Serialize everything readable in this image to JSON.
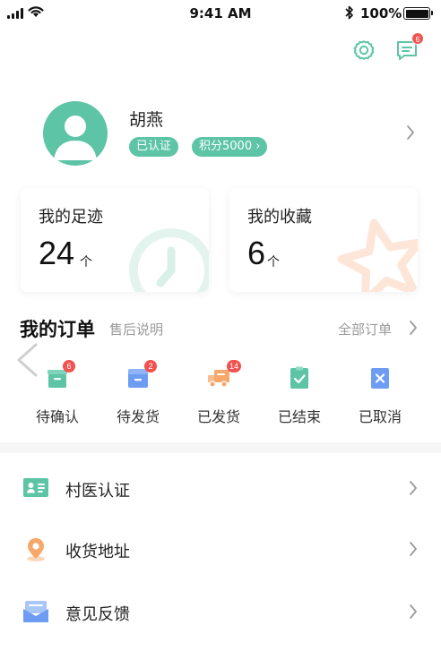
{
  "status_bar": {
    "time": "9:41 AM",
    "battery": "100%"
  },
  "header": {
    "message_badge": "6"
  },
  "profile": {
    "name": "胡燕",
    "verified_label": "已认证",
    "points_label": "积分5000 ›"
  },
  "stats": [
    {
      "title": "我的足迹",
      "value": "24",
      "unit": "个"
    },
    {
      "title": "我的收藏",
      "value": "6",
      "unit": "个"
    }
  ],
  "orders": {
    "title": "我的订单",
    "subtitle": "售后说明",
    "all_label": "全部订单",
    "items": [
      {
        "label": "待确认",
        "badge": "6",
        "icon": "box-icon",
        "color": "#5dc4a6"
      },
      {
        "label": "待发货",
        "badge": "2",
        "icon": "package-icon",
        "color": "#6d9df2"
      },
      {
        "label": "已发货",
        "badge": "14",
        "icon": "truck-icon",
        "color": "#f6a86a"
      },
      {
        "label": "已结束",
        "badge": "",
        "icon": "check-clipboard-icon",
        "color": "#5dc4a6"
      },
      {
        "label": "已取消",
        "badge": "",
        "icon": "cancel-icon",
        "color": "#6d9df2"
      }
    ]
  },
  "menu": [
    {
      "label": "村医认证",
      "icon": "id-card-icon"
    },
    {
      "label": "收货地址",
      "icon": "location-pin-icon"
    },
    {
      "label": "意见反馈",
      "icon": "feedback-mail-icon"
    }
  ],
  "colors": {
    "accent": "#5dc4a6",
    "badge": "#f0524f",
    "blue": "#6d9df2",
    "orange": "#f6a86a"
  }
}
